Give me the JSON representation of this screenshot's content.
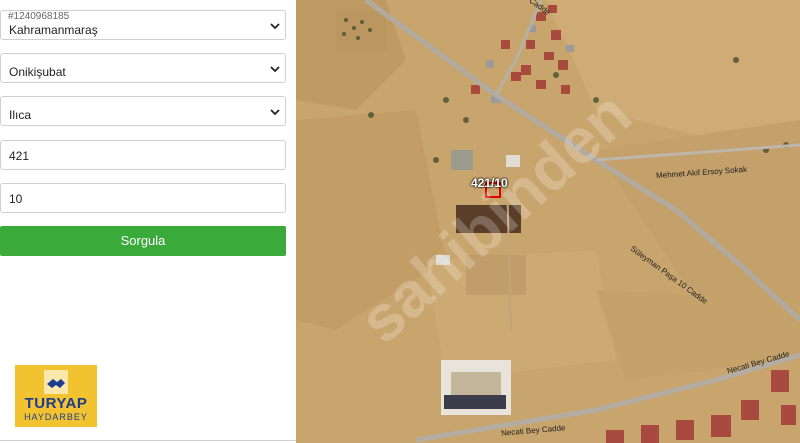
{
  "listing_id": "#1240968185",
  "form": {
    "province": {
      "value": "Kahramanmaraş",
      "icon": "chevron-down-icon"
    },
    "district": {
      "value": "Onikişubat",
      "icon": "chevron-down-icon"
    },
    "neighborhood": {
      "value": "Ilıca",
      "icon": "chevron-down-icon"
    },
    "block": {
      "value": "421"
    },
    "parcel": {
      "value": "10"
    },
    "submit_label": "Sorgula"
  },
  "logo": {
    "brand": "TURYAP",
    "sub": "HAYDARBEY"
  },
  "map": {
    "parcel_label": "421/10",
    "watermark": "sahibinden",
    "streets": {
      "top": "Cadde",
      "mehmet_akif": "Mehmet Akif Ersoy Sokak",
      "suleyman_pasa": "Süleyman Paşa 10 Cadde",
      "necati_right": "Necati Bey Cadde",
      "necati_bottom": "Necati Bey Cadde"
    }
  },
  "colors": {
    "submit": "#3aaa3a",
    "logo_bg": "#f2c230",
    "logo_text": "#1a3d8f"
  }
}
